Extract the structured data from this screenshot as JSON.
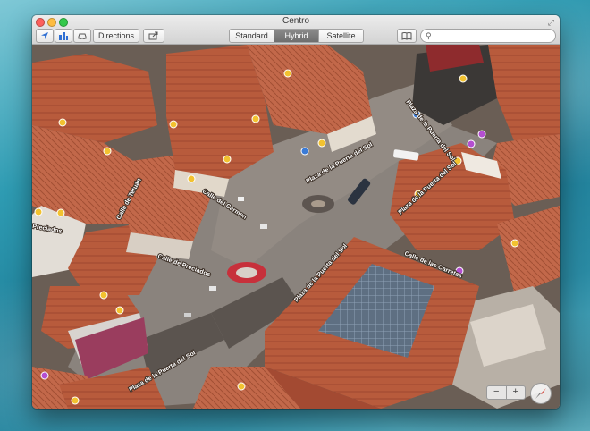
{
  "window": {
    "title": "Centro"
  },
  "toolbar": {
    "location_icon": "location-arrow-icon",
    "view3d_icon": "3d-buildings-icon",
    "traffic_icon": "car-icon",
    "directions_label": "Directions",
    "share_icon": "share-icon",
    "map_types": [
      {
        "label": "Standard",
        "active": false
      },
      {
        "label": "Hybrid",
        "active": true
      },
      {
        "label": "Satellite",
        "active": false
      }
    ],
    "bookmarks_icon": "book-icon",
    "search_placeholder": "",
    "search_value": ""
  },
  "map": {
    "street_labels": [
      "Calle de Tetuán",
      "Calle del Carmen",
      "Calle de Preciados",
      "Plaza de la Puerta del Sol",
      "Plaza de la Puerta del Sol",
      "Plaza de la Puerta del Sol",
      "Plaza de la Puerta del Sol",
      "Plaza de la Puerta del Sol",
      "Calle de las Carretas",
      "Preciados"
    ]
  },
  "controls": {
    "zoom_out": "−",
    "zoom_in": "+",
    "compass_icon": "compass-icon"
  },
  "colors": {
    "accent_blue": "#2f6fd3",
    "poi_yellow": "#f2c230",
    "poi_purple": "#b44fd1",
    "roof_terracotta": "#b7563a"
  }
}
